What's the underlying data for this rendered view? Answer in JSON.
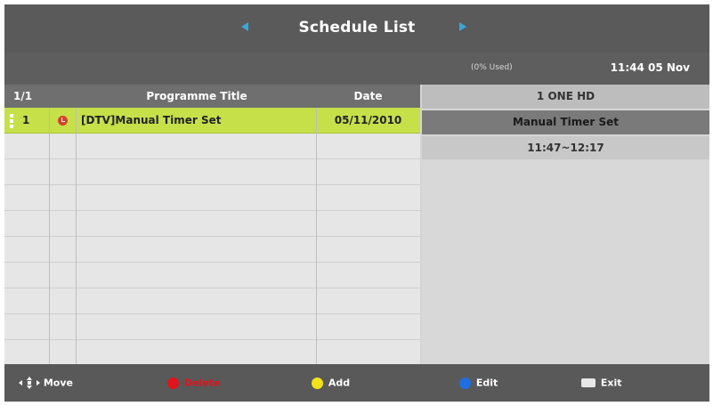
{
  "header": {
    "title": "Schedule List",
    "usage": "(0% Used)",
    "time": "11:44 05 Nov",
    "arrow_color": "#3aa7d8"
  },
  "list": {
    "page": "1/1",
    "col_title": "Programme Title",
    "col_date": "Date",
    "rows": [
      {
        "num": "1",
        "title": "[DTV]Manual Timer Set",
        "date": "05/11/2010",
        "selected": true,
        "icon": "record-icon"
      }
    ],
    "highlight_color": "#c6e04a"
  },
  "detail": {
    "channel": "1 ONE HD",
    "event": "Manual Timer Set",
    "time_range": "11:47~12:17"
  },
  "footer": {
    "move_label": "Move",
    "delete_label": "Delete",
    "add_label": "Add",
    "edit_label": "Edit",
    "exit_label": "Exit",
    "red": "#e0141c",
    "yellow": "#f2e21a",
    "blue": "#1f6fe0"
  }
}
